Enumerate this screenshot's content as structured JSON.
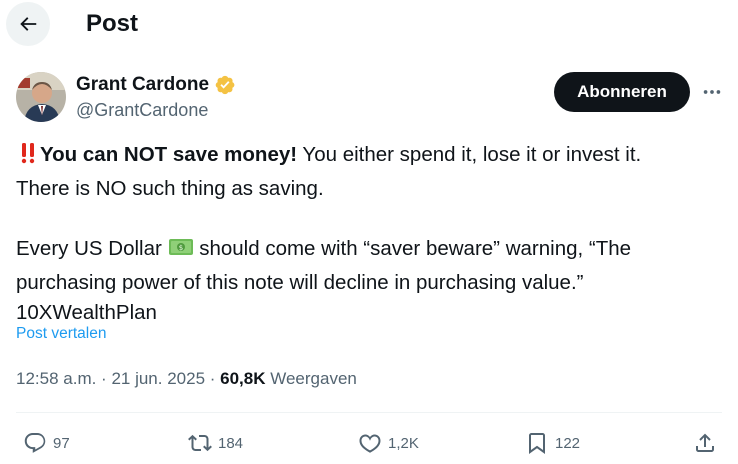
{
  "header": {
    "title": "Post",
    "back_icon": "arrow-left-icon"
  },
  "author": {
    "name": "Grant Cardone",
    "handle": "@GrantCardone",
    "verified_color": "#f4c243"
  },
  "actions_top": {
    "subscribe_label": "Abonneren",
    "more_icon": "more-icon"
  },
  "post": {
    "line1_emoji": "‼️",
    "line1_bold": "You can NOT save money!",
    "line1_rest": " You either spend it, lose it or invest it.",
    "line2": "There is NO such thing as saving.",
    "para2_start": "Every US Dollar ",
    "para2_emoji": "💵",
    "para2_rest": " should come with “saver beware” warning, “The",
    "para2_line2": "purchasing power of this note will decline in purchasing value.”",
    "para2_line3": "10XWealthPlan",
    "translate_label": "Post vertalen"
  },
  "meta": {
    "time": "12:58 a.m.",
    "date": "21 jun. 2025",
    "separator": " · ",
    "views_count": "60,8K",
    "views_label": " Weergaven"
  },
  "stats": {
    "replies": "97",
    "reposts": "184",
    "likes": "1,2K",
    "bookmarks": "122"
  },
  "colors": {
    "link": "#1d9bf0",
    "muted": "#536471",
    "text": "#0f1419"
  }
}
